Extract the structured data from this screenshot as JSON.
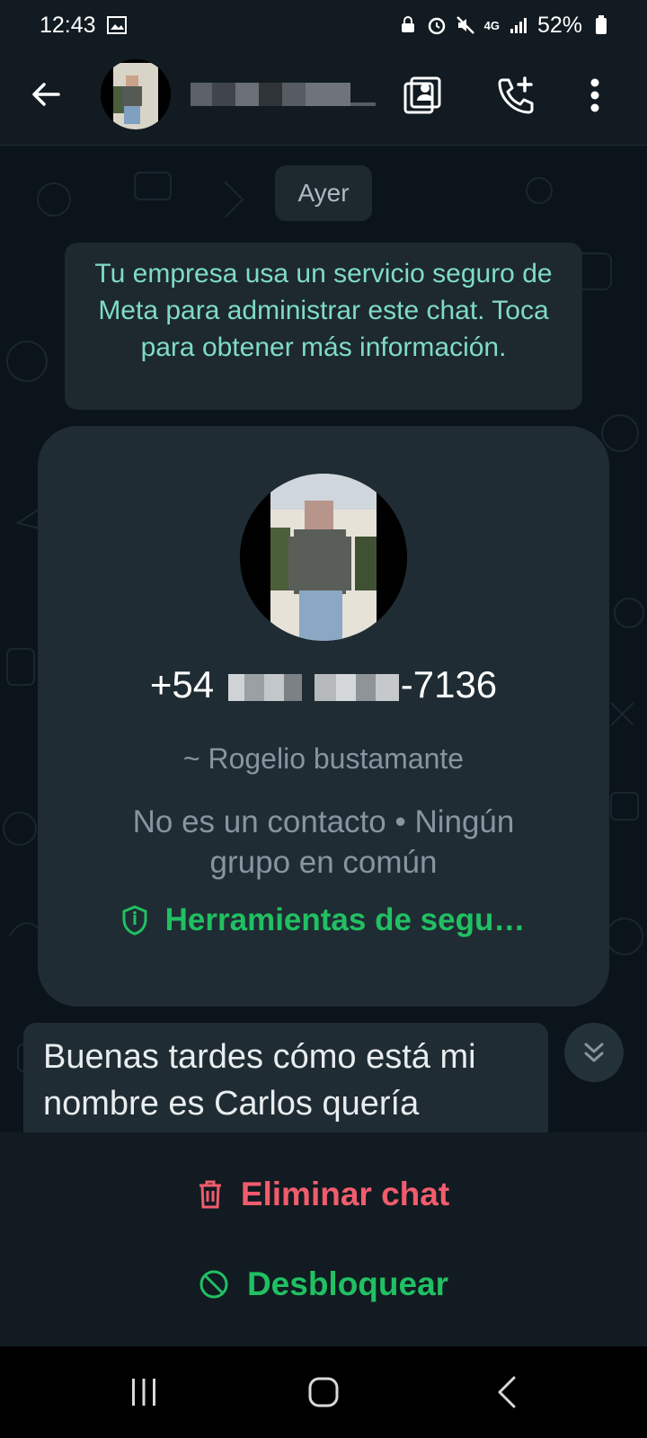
{
  "status_bar": {
    "time": "12:43",
    "network": "4G",
    "battery": "52%"
  },
  "header": {
    "contact_name": "",
    "icons": [
      "back-arrow-icon",
      "contact-card-icon",
      "add-call-icon",
      "more-vert-icon"
    ]
  },
  "chat": {
    "date_chip": "Ayer",
    "system_message": "Tu empresa usa un servicio seguro de Meta para administrar este chat. Toca para obtener más información.",
    "profile_card": {
      "phone_prefix": "+54",
      "phone_suffix": "-7136",
      "push_name": "~ Rogelio bustamante",
      "context": "No es un contacto • Ningún grupo en común",
      "safety_link": "Herramientas de segu…"
    },
    "incoming_message": "Buenas tardes cómo está mi nombre es Carlos quería"
  },
  "actions": {
    "delete_label": "Eliminar chat",
    "unblock_label": "Desbloquear"
  },
  "colors": {
    "accent_green": "#21c063",
    "danger_red": "#f15c6d",
    "system_text": "#7fdcc2",
    "background": "#0b141a"
  }
}
